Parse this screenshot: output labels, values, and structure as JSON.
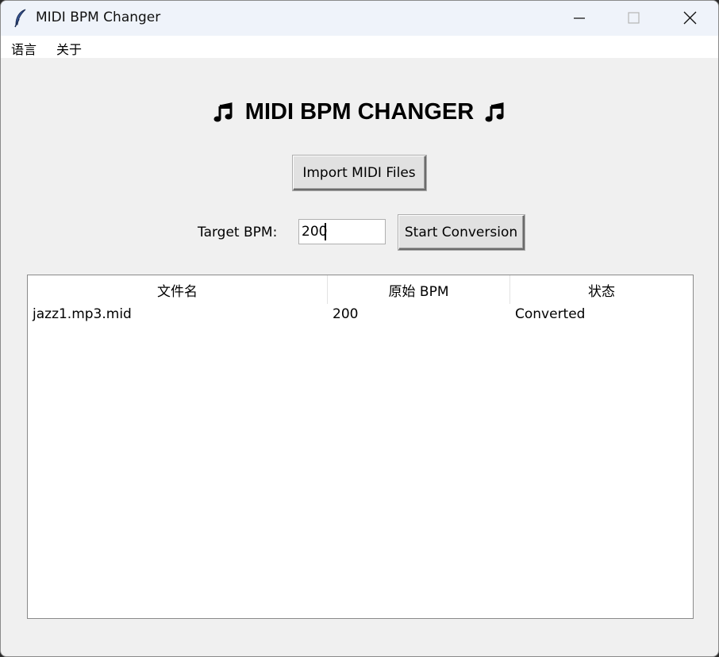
{
  "window": {
    "title": "MIDI BPM Changer",
    "icons": {
      "app": "feather-icon",
      "minimize": "minimize-icon",
      "maximize": "maximize-icon",
      "close": "close-icon"
    }
  },
  "menu": {
    "language": "语言",
    "about": "关于"
  },
  "main": {
    "heading": "MIDI BPM CHANGER",
    "heading_icon": "music-note-icon",
    "import_button": "Import MIDI Files",
    "target_bpm_label": "Target BPM:",
    "target_bpm_value": "200",
    "start_button": "Start Conversion"
  },
  "table": {
    "columns": [
      "文件名",
      "原始 BPM",
      "状态"
    ],
    "rows": [
      {
        "filename": "jazz1.mp3.mid",
        "original_bpm": "200",
        "status": "Converted"
      }
    ]
  },
  "colors": {
    "window_bg": "#f0f0f0",
    "titlebar_bg": "#eff3fa",
    "table_bg": "#ffffff"
  }
}
